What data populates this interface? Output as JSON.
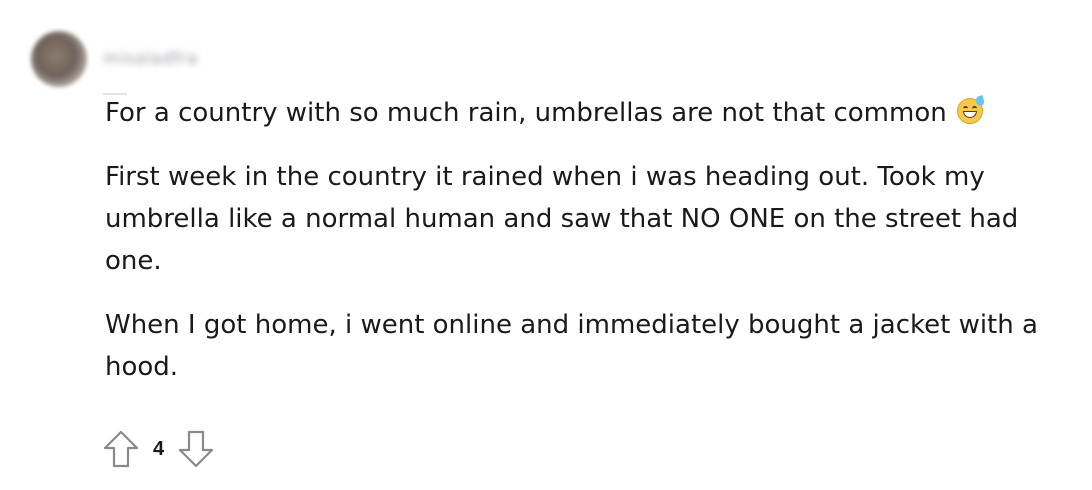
{
  "comment": {
    "author": "misaladfra",
    "paragraphs": [
      "For a country with so much rain, umbrellas are not that common",
      "First week in the country it rained when i was heading out. Took my umbrella like a normal human and saw that NO ONE on the street had one.",
      "When I got home, i went online and immediately bought a jacket with a hood."
    ],
    "emoji": "grinning-face-with-sweat",
    "score": "4"
  },
  "icons": {
    "upvote": "arrow-up-outline-icon",
    "downvote": "arrow-down-outline-icon"
  },
  "colors": {
    "text": "#1a1a1b",
    "icon_stroke": "#878a8c",
    "emoji_face": "#f7c948"
  }
}
